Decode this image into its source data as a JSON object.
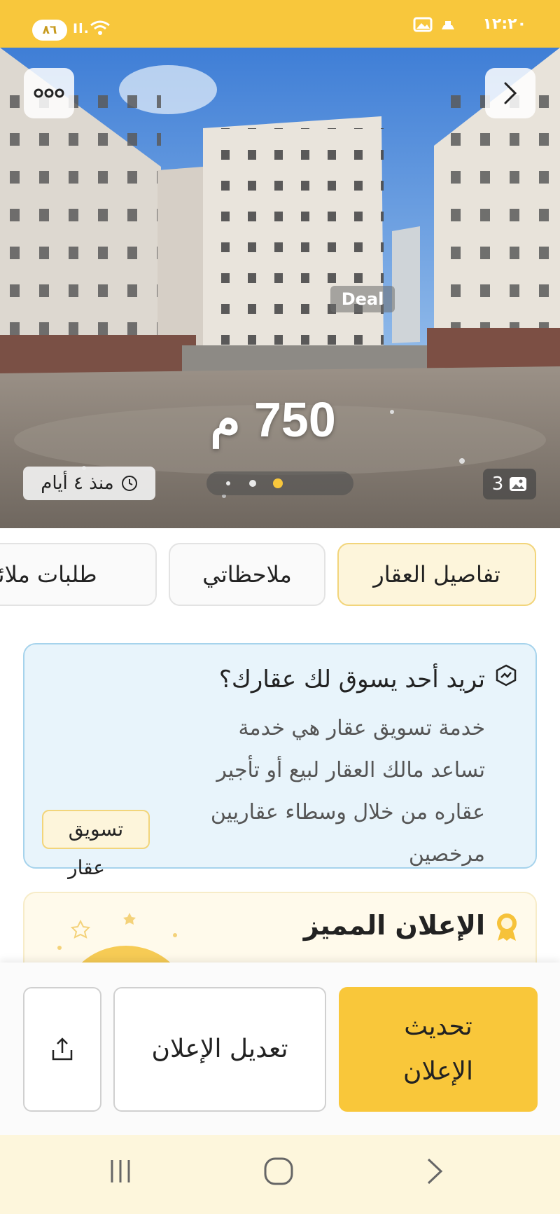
{
  "status_bar": {
    "time": "١٢:٢٠",
    "battery": "٨٦",
    "signal": "Il.",
    "icons": [
      "whatsapp-icon",
      "gallery-icon",
      "wifi-icon",
      "signal-icon"
    ]
  },
  "hero": {
    "watermark": "Deal",
    "area_text": "750 م",
    "posted_text": "منذ ٤ أيام",
    "photo_count": "3",
    "carousel": {
      "total": 3,
      "active_index": 2
    },
    "buttons": [
      "more-options",
      "back"
    ]
  },
  "tabs": [
    {
      "label": "تفاصيل العقار",
      "active": true
    },
    {
      "label": "ملاحظاتي",
      "active": false
    },
    {
      "label": "طلبات ملائمة",
      "active": false
    }
  ],
  "marketing_card": {
    "title": "تريد أحد يسوق لك عقارك؟",
    "description": "خدمة تسويق عقار هي خدمة تساعد مالك العقار لبيع أو تأجير عقاره من خلال وسطاء عقاريين مرخصين",
    "tag_line1": "تسويق",
    "tag_line2": "عقار"
  },
  "featured_card": {
    "title": "الإعلان المميز"
  },
  "bottom_actions": {
    "share_icon": "share-icon",
    "edit_label": "تعديل الإعلان",
    "renew_label": "تحديث الإعلان"
  },
  "colors": {
    "accent": "#f8c73c",
    "tab_active_bg": "#fdf5db",
    "info_card_bg": "#e8f4fb",
    "info_card_border": "#a6d3ec"
  }
}
